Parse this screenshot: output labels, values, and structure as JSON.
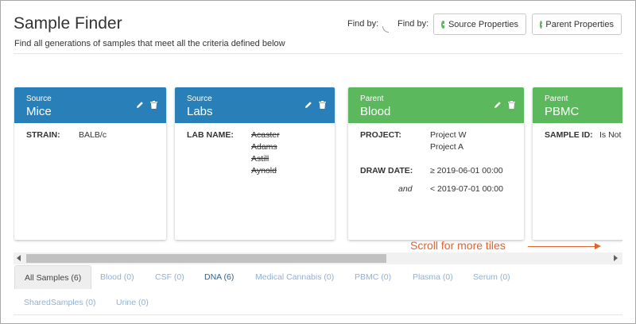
{
  "header": {
    "title": "Sample Finder",
    "subtitle": "Find all generations of samples that meet all the criteria defined below",
    "find_by_1": "Find by:",
    "find_by_2": "Find by:",
    "source_properties_button": "Source Properties",
    "parent_properties_button": "Parent Properties"
  },
  "colors": {
    "source_header": "#2980b9",
    "parent_header": "#5cb85c",
    "hint": "#e0622f"
  },
  "tiles": [
    {
      "kind": "Source",
      "name": "Mice",
      "filters": [
        {
          "label": "STRAIN:",
          "values": [
            "BALB/c"
          ]
        }
      ]
    },
    {
      "kind": "Source",
      "name": "Labs",
      "filters": [
        {
          "label": "LAB NAME:",
          "values": [
            "Acaster",
            "Adams",
            "Astill",
            "Aynold"
          ],
          "struck": true
        }
      ]
    },
    {
      "kind": "Parent",
      "name": "Blood",
      "filters": [
        {
          "label": "PROJECT:",
          "values": [
            "Project W",
            "Project A"
          ]
        },
        {
          "label": "DRAW DATE:",
          "values": [
            "≥ 2019-06-01 00:00"
          ]
        },
        {
          "operator": "and",
          "values": [
            "< 2019-07-01 00:00"
          ]
        }
      ]
    },
    {
      "kind": "Parent",
      "name": "PBMC",
      "filters": [
        {
          "label": "SAMPLE ID:",
          "values": [
            "Is Not"
          ]
        }
      ]
    }
  ],
  "hint": "Scroll for more tiles",
  "tabs": [
    {
      "label": "All Samples (6)",
      "active": true
    },
    {
      "label": "Blood (0)"
    },
    {
      "label": "CSF (0)"
    },
    {
      "label": "DNA (6)",
      "bold": true
    },
    {
      "label": "Medical Cannabis (0)"
    },
    {
      "label": "PBMC (0)"
    },
    {
      "label": "Plasma (0)"
    },
    {
      "label": "Serum (0)"
    },
    {
      "label": "SharedSamples (0)"
    },
    {
      "label": "Urine (0)"
    }
  ]
}
